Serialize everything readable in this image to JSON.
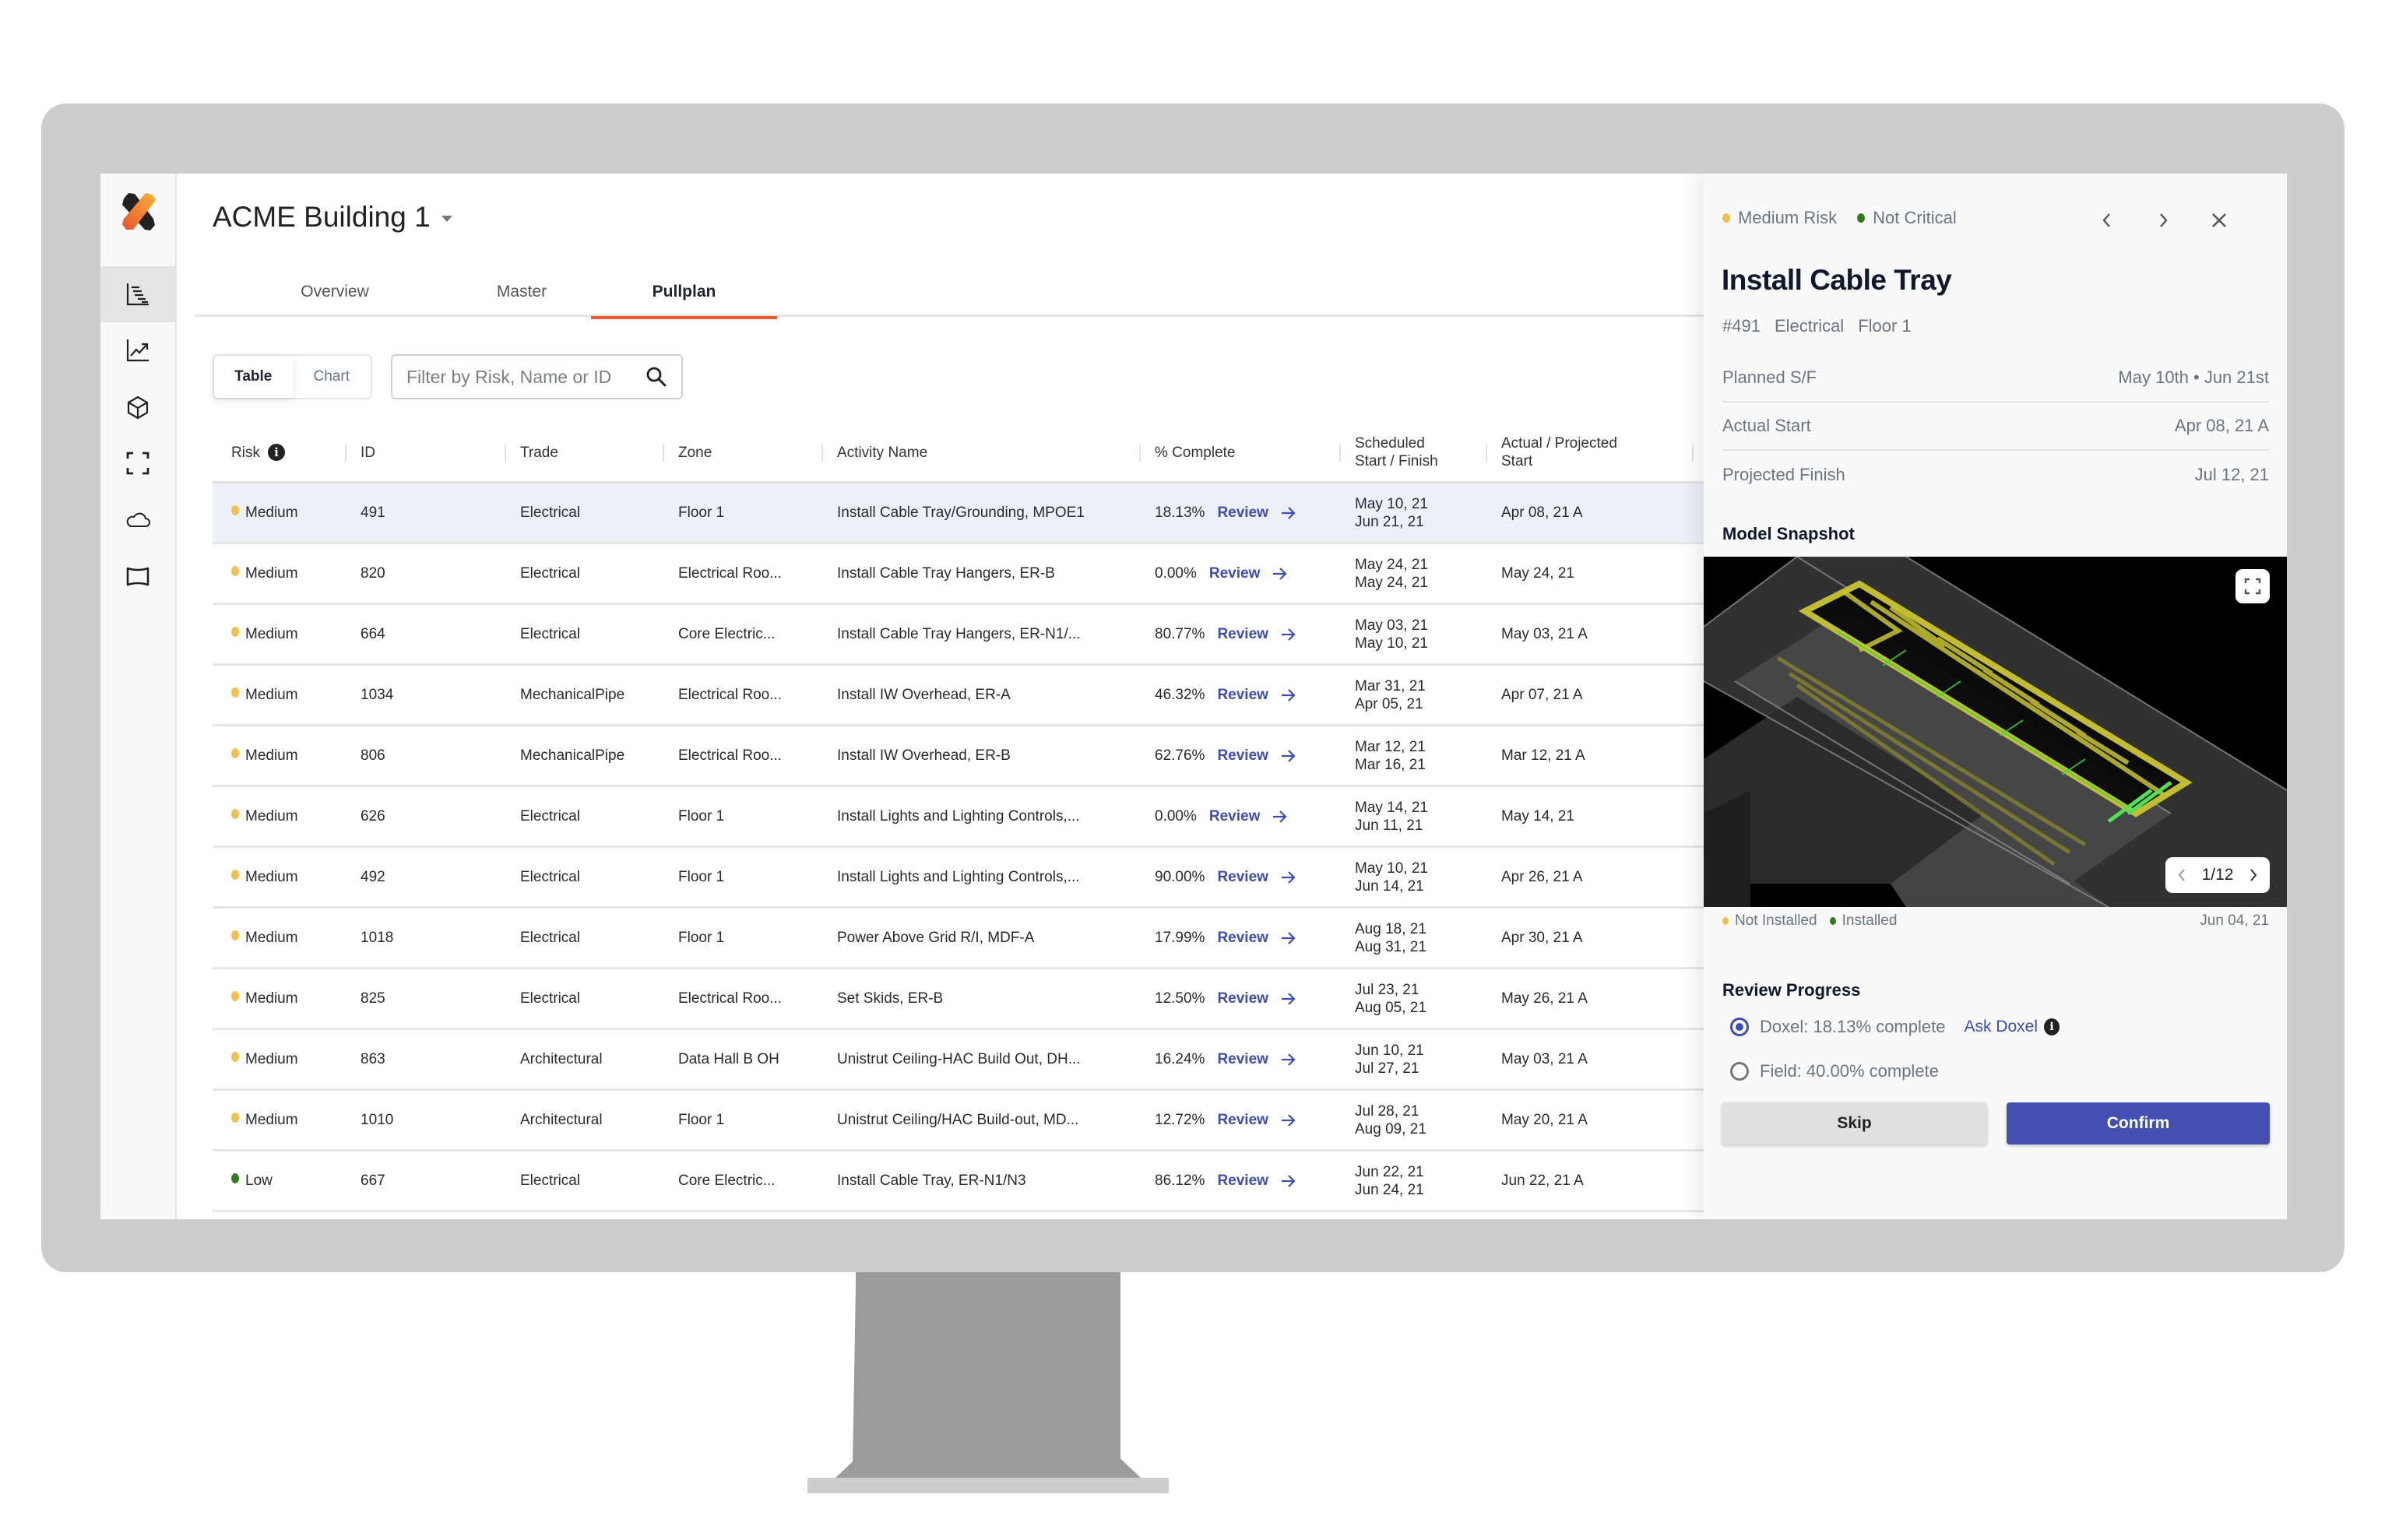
{
  "app": {
    "project_title": "ACME Building 1",
    "brand_colors": {
      "accent": "#ea5b2d",
      "primary": "#4350af",
      "link": "#3e4db0",
      "medium_risk": "#f3c04d",
      "low_risk": "#2f7d1f"
    }
  },
  "sidebar": {
    "items": [
      {
        "name": "schedule",
        "icon": "gantt-icon",
        "active": true
      },
      {
        "name": "analytics",
        "icon": "trend-chart-icon",
        "active": false
      },
      {
        "name": "model",
        "icon": "cube-icon",
        "active": false
      },
      {
        "name": "capture",
        "icon": "focus-frame-icon",
        "active": false
      },
      {
        "name": "cloud",
        "icon": "cloud-icon",
        "active": false
      },
      {
        "name": "panorama",
        "icon": "panorama-icon",
        "active": false
      }
    ]
  },
  "tabs": [
    {
      "label": "Overview",
      "active": false
    },
    {
      "label": "Master",
      "active": false
    },
    {
      "label": "Pullplan",
      "active": true
    }
  ],
  "view_toggle": {
    "table_label": "Table",
    "chart_label": "Chart",
    "selected": "Table"
  },
  "search": {
    "placeholder": "Filter by Risk, Name or ID",
    "value": ""
  },
  "table": {
    "columns": {
      "risk": "Risk",
      "id": "ID",
      "trade": "Trade",
      "zone": "Zone",
      "activity": "Activity Name",
      "complete": "% Complete",
      "scheduled_1": "Scheduled",
      "scheduled_2": "Start / Finish",
      "actual_1": "Actual / Projected",
      "actual_2": "Start"
    },
    "review_label": "Review",
    "rows": [
      {
        "risk": "Medium",
        "id": "491",
        "trade": "Electrical",
        "zone": "Floor 1",
        "activity": "Install Cable Tray/Grounding, MPOE1",
        "complete": "18.13%",
        "sched_start": "May 10, 21",
        "sched_finish": "Jun 21, 21",
        "actual": "Apr 08, 21 A",
        "selected": true
      },
      {
        "risk": "Medium",
        "id": "820",
        "trade": "Electrical",
        "zone": "Electrical Roo...",
        "activity": "Install Cable Tray Hangers, ER-B",
        "complete": "0.00%",
        "sched_start": "May 24, 21",
        "sched_finish": "May 24, 21",
        "actual": "May 24, 21"
      },
      {
        "risk": "Medium",
        "id": "664",
        "trade": "Electrical",
        "zone": "Core Electric...",
        "activity": "Install Cable Tray Hangers, ER-N1/...",
        "complete": "80.77%",
        "sched_start": "May 03, 21",
        "sched_finish": "May 10, 21",
        "actual": "May 03, 21 A"
      },
      {
        "risk": "Medium",
        "id": "1034",
        "trade": "MechanicalPipe",
        "zone": "Electrical Roo...",
        "activity": "Install IW Overhead, ER-A",
        "complete": "46.32%",
        "sched_start": "Mar 31, 21",
        "sched_finish": "Apr 05, 21",
        "actual": "Apr 07, 21 A"
      },
      {
        "risk": "Medium",
        "id": "806",
        "trade": "MechanicalPipe",
        "zone": "Electrical Roo...",
        "activity": "Install IW Overhead, ER-B",
        "complete": "62.76%",
        "sched_start": "Mar 12, 21",
        "sched_finish": "Mar 16, 21",
        "actual": "Mar 12, 21 A"
      },
      {
        "risk": "Medium",
        "id": "626",
        "trade": "Electrical",
        "zone": "Floor 1",
        "activity": "Install Lights and Lighting Controls,...",
        "complete": "0.00%",
        "sched_start": "May 14, 21",
        "sched_finish": "Jun 11, 21",
        "actual": "May 14, 21"
      },
      {
        "risk": "Medium",
        "id": "492",
        "trade": "Electrical",
        "zone": "Floor 1",
        "activity": "Install Lights and Lighting Controls,...",
        "complete": "90.00%",
        "sched_start": "May 10, 21",
        "sched_finish": "Jun 14, 21",
        "actual": "Apr 26, 21 A"
      },
      {
        "risk": "Medium",
        "id": "1018",
        "trade": "Electrical",
        "zone": "Floor 1",
        "activity": "Power Above Grid R/I, MDF-A",
        "complete": "17.99%",
        "sched_start": "Aug 18, 21",
        "sched_finish": "Aug 31, 21",
        "actual": "Apr 30, 21 A"
      },
      {
        "risk": "Medium",
        "id": "825",
        "trade": "Electrical",
        "zone": "Electrical Roo...",
        "activity": "Set Skids, ER-B",
        "complete": "12.50%",
        "sched_start": "Jul 23, 21",
        "sched_finish": "Aug 05, 21",
        "actual": "May 26, 21 A"
      },
      {
        "risk": "Medium",
        "id": "863",
        "trade": "Architectural",
        "zone": "Data Hall B OH",
        "activity": "Unistrut Ceiling-HAC Build Out, DH...",
        "complete": "16.24%",
        "sched_start": "Jun 10, 21",
        "sched_finish": "Jul 27, 21",
        "actual": "May 03, 21 A"
      },
      {
        "risk": "Medium",
        "id": "1010",
        "trade": "Architectural",
        "zone": "Floor 1",
        "activity": "Unistrut Ceiling/HAC Build-out, MD...",
        "complete": "12.72%",
        "sched_start": "Jul 28, 21",
        "sched_finish": "Aug 09, 21",
        "actual": "May 20, 21 A"
      },
      {
        "risk": "Low",
        "id": "667",
        "trade": "Electrical",
        "zone": "Core Electric...",
        "activity": "Install Cable Tray, ER-N1/N3",
        "complete": "86.12%",
        "sched_start": "Jun 22, 21",
        "sched_finish": "Jun 24, 21",
        "actual": "Jun 22, 21 A"
      }
    ]
  },
  "panel": {
    "risk_badge": "Medium Risk",
    "critical_badge": "Not Critical",
    "title": "Install Cable Tray",
    "meta": {
      "id": "#491",
      "trade": "Electrical",
      "zone": "Floor 1"
    },
    "details": [
      {
        "label": "Planned S/F",
        "value": "May 10th • Jun 21st"
      },
      {
        "label": "Actual Start",
        "value": "Apr 08, 21 A"
      },
      {
        "label": "Projected Finish",
        "value": "Jul 12, 21"
      }
    ],
    "snapshot": {
      "heading": "Model Snapshot",
      "page": "1/12",
      "legend_not_installed": "Not Installed",
      "legend_installed": "Installed",
      "date": "Jun 04, 21"
    },
    "review": {
      "heading": "Review Progress",
      "doxel_option": "Doxel: 18.13% complete",
      "ask_label": "Ask Doxel",
      "field_option": "Field: 40.00% complete",
      "selected": "doxel"
    },
    "skip_label": "Skip",
    "confirm_label": "Confirm"
  }
}
